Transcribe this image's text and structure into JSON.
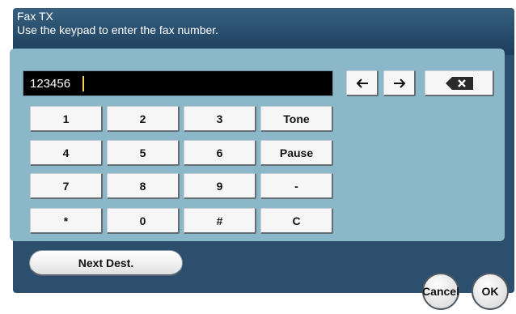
{
  "header": {
    "title": "Fax TX",
    "instruction": "Use the keypad to enter the fax number."
  },
  "entry": {
    "value": "123456"
  },
  "keypad": {
    "rows": [
      [
        "1",
        "2",
        "3",
        "Tone"
      ],
      [
        "4",
        "5",
        "6",
        "Pause"
      ],
      [
        "7",
        "8",
        "9",
        "-"
      ],
      [
        "*",
        "0",
        "#",
        "C"
      ]
    ]
  },
  "nav": {
    "left_icon": "arrow-left-icon",
    "right_icon": "arrow-right-icon",
    "backspace_icon": "backspace-icon"
  },
  "buttons": {
    "next_dest": "Next Dest.",
    "cancel": "Cancel",
    "ok": "OK"
  },
  "colors": {
    "header": "#2d4f6e",
    "panel": "#8ab8c8",
    "entry_bg": "#000000",
    "caret": "#f5d542"
  }
}
